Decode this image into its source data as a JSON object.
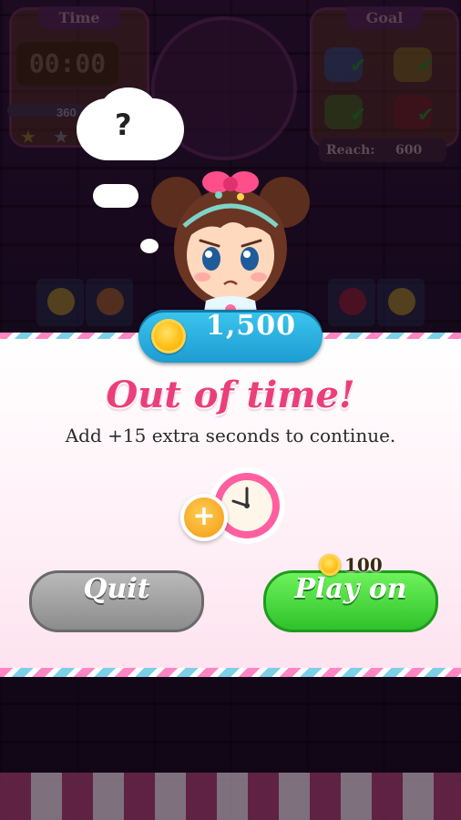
{
  "hud": {
    "time_label": "Time",
    "time_value": "00:00",
    "score_value": "360",
    "goal_label": "Goal",
    "reach_label": "Reach:",
    "reach_value": "600"
  },
  "thought": {
    "symbol": "?"
  },
  "coins": {
    "amount": "1,500"
  },
  "dialog": {
    "title": "Out of time!",
    "message": "Add +15 extra seconds to continue.",
    "plus_symbol": "+"
  },
  "buttons": {
    "quit_label": "Quit",
    "play_on_label": "Play on",
    "play_on_cost": "100"
  },
  "colors": {
    "accent_pink": "#ea3f7a",
    "coin_pill": "#2bb3e3",
    "play_green": "#3fd13a",
    "quit_gray": "#9e9e9e"
  },
  "icons": [
    "coin-icon",
    "clock-icon",
    "plus-icon",
    "star-icon",
    "checkmark-icon",
    "question-icon"
  ]
}
